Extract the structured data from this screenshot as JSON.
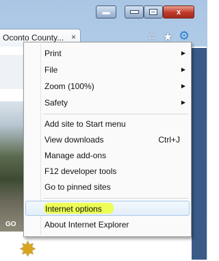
{
  "titlebar": {
    "extra_label": "▬",
    "minimize_label": "",
    "maximize_label": "",
    "close_label": "x"
  },
  "tab": {
    "title": "Oconto County...",
    "close_label": "×"
  },
  "toolbar": {
    "home_icon": "home-icon",
    "favorites_icon": "star-icon",
    "tools_icon": "gear-icon"
  },
  "page": {
    "photo_label": "GO"
  },
  "menu": {
    "items": [
      {
        "label": "Print",
        "submenu": true
      },
      {
        "label": "File",
        "submenu": true
      },
      {
        "label": "Zoom (100%)",
        "submenu": true
      },
      {
        "label": "Safety",
        "submenu": true
      },
      {
        "label": "Add site to Start menu"
      },
      {
        "label": "View downloads",
        "shortcut": "Ctrl+J"
      },
      {
        "label": "Manage add-ons"
      },
      {
        "label": "F12 developer tools"
      },
      {
        "label": "Go to pinned sites"
      },
      {
        "label": "Internet options",
        "highlighted": true
      },
      {
        "label": "About Internet Explorer"
      }
    ],
    "arrow": "▶"
  },
  "colors": {
    "highlight_marker": "#ecff3a",
    "close_button": "#c0392b"
  }
}
